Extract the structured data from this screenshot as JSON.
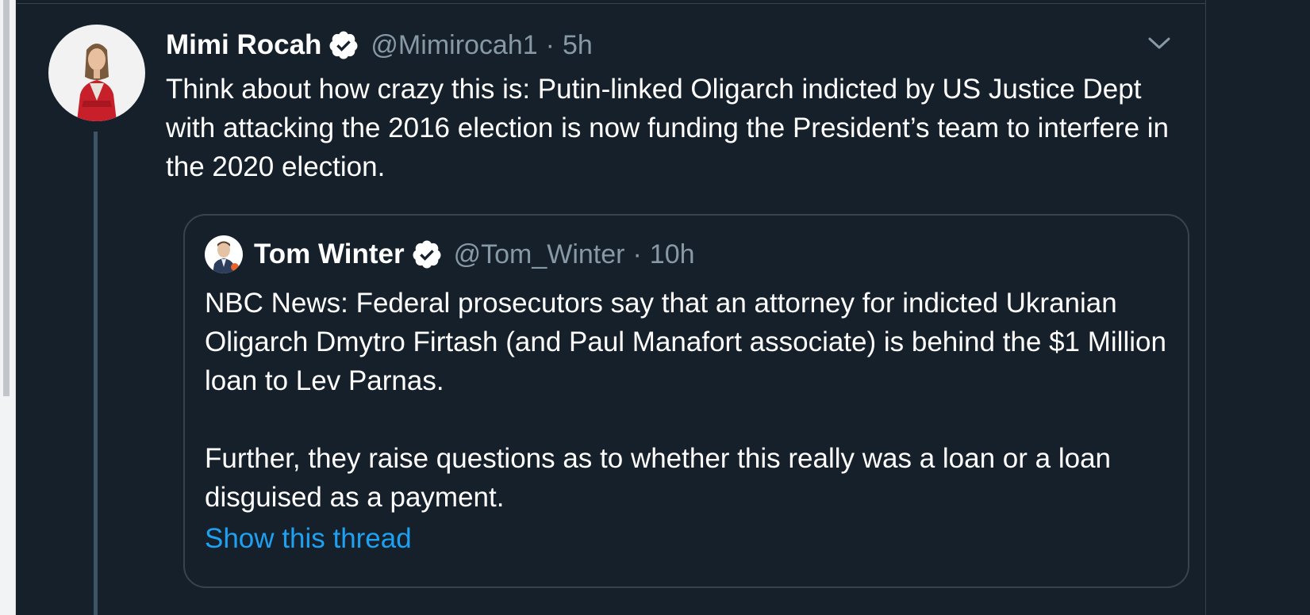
{
  "tweet": {
    "author_name": "Mimi Rocah",
    "handle": "@Mimirocah1",
    "separator": "·",
    "time": "5h",
    "text": "Think about how crazy this is: Putin-linked Oligarch indicted by US Justice Dept with attacking the 2016 election is now funding the President’s team to interfere in the 2020 election."
  },
  "quoted_tweet": {
    "author_name": "Tom Winter",
    "handle": "@Tom_Winter",
    "separator": "·",
    "time": "10h",
    "paragraph1": "NBC News: Federal prosecutors say that an attorney for indicted Ukranian Oligarch Dmytro Firtash (and Paul Manafort associate) is behind the $1 Million loan to Lev Parnas.",
    "paragraph2": "Further, they raise questions as to whether this really was a loan or a loan disguised as a payment.",
    "show_thread": "Show this thread"
  },
  "icons": {
    "verified": "verified-badge-icon",
    "caret": "chevron-down-icon"
  },
  "colors": {
    "background": "#15202b",
    "border": "#38444d",
    "secondary_text": "#8899a6",
    "link": "#1da1f2"
  }
}
